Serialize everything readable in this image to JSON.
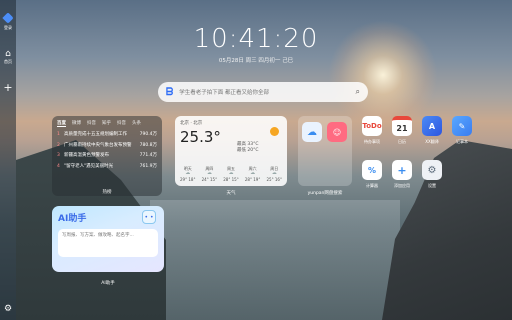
{
  "sidebar": {
    "items": [
      {
        "icon": "bookmark-icon",
        "label": "登录"
      },
      {
        "icon": "home-icon",
        "label": "首页"
      }
    ],
    "add_symbol": "+",
    "settings_icon": "gear-icon"
  },
  "clock": {
    "time": "10:41:20",
    "date": "05月28日 周三  四月初一 己巳"
  },
  "search": {
    "placeholder": "学生看老子拍下面 都正看又给你全部"
  },
  "news": {
    "tabs": [
      "百度",
      "微博",
      "抖音",
      "知乎",
      "抖音",
      "头条"
    ],
    "active_tab": 0,
    "items": [
      {
        "rank": "1",
        "title": "高质量完成十五五规划编制工作",
        "heat": "790.4万"
      },
      {
        "rank": "2",
        "title": "广州暴雨持续中央气象台发布预警",
        "heat": "780.8万"
      },
      {
        "rank": "3",
        "title": "新疆高温黄色预警发布",
        "heat": "771.4万"
      },
      {
        "rank": "4",
        "title": "\"留守老人\"遇见美丽时光",
        "heat": "761.9万"
      }
    ],
    "caption": "热榜"
  },
  "weather": {
    "location": "北京 · 北京",
    "temp": "25.3°",
    "range_high": "最高 33°C",
    "range_low": "最低 20°C",
    "days": [
      {
        "name": "明天",
        "range": "29° 18°"
      },
      {
        "name": "周四",
        "range": "24° 15°"
      },
      {
        "name": "周五",
        "range": "28° 15°"
      },
      {
        "name": "周六",
        "range": "28° 19°"
      },
      {
        "name": "周日",
        "range": "25° 16°"
      }
    ],
    "caption": "天气"
  },
  "yunpan": {
    "caption": "yunpan网盘搜索"
  },
  "apps": [
    {
      "name": "待办事项",
      "icon": "todo-icon",
      "text": "To Do",
      "color": "#e8483b"
    },
    {
      "name": "日历",
      "icon": "calendar-icon",
      "text": "21",
      "color": "#f4f4f4"
    },
    {
      "name": "XX翻译",
      "icon": "translate-icon",
      "text": "A",
      "color": "#3a64f0"
    },
    {
      "name": "记事本",
      "icon": "notebook-icon",
      "text": "✎",
      "color": "#4a9ef5"
    },
    {
      "name": "计算器",
      "icon": "calculator-icon",
      "text": "%",
      "color": "#f0f0f0"
    },
    {
      "name": "添加应用",
      "icon": "add-app-icon",
      "text": "+",
      "color": "#f0f0f0"
    },
    {
      "name": "设置",
      "icon": "settings-icon",
      "text": "⚙",
      "color": "#f0f0f0"
    }
  ],
  "ai": {
    "title": "AI助手",
    "placeholder": "写周报、写方案、做攻略、起名字...",
    "caption": "AI助手"
  }
}
